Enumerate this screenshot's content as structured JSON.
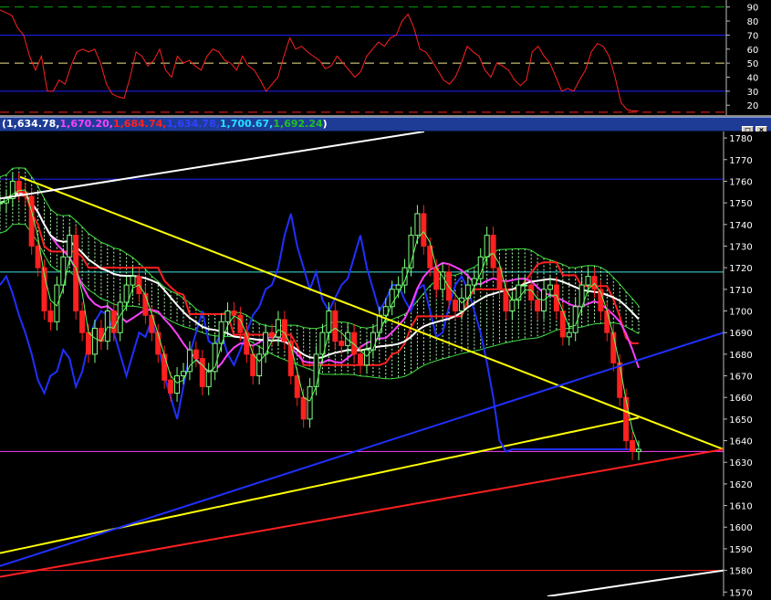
{
  "window": {
    "legend_values": [
      {
        "text": "(1,634.78,",
        "color": "#ffffff"
      },
      {
        "text": "1,670.20,",
        "color": "#ff40ff"
      },
      {
        "text": "1,684.74,",
        "color": "#ff2020"
      },
      {
        "text": "1,634.78,",
        "color": "#3040ff"
      },
      {
        "text": "1,700.67,",
        "color": "#20e0ff"
      },
      {
        "text": "1,692.24",
        "color": "#20c020"
      },
      {
        "text": ")",
        "color": "#ffffff"
      }
    ],
    "restore_label": "□",
    "close_label": "×"
  },
  "chart_data": [
    {
      "type": "line",
      "panel": "oscillator",
      "yticks": [
        20,
        30,
        40,
        50,
        60,
        70,
        80,
        90
      ],
      "ylim": [
        13,
        95
      ],
      "reference_lines": [
        {
          "value": 90,
          "color": "#00a000",
          "style": "dashed"
        },
        {
          "value": 70,
          "color": "#2020ff",
          "style": "solid"
        },
        {
          "value": 50,
          "color": "#f0e68c",
          "style": "dashed"
        },
        {
          "value": 30,
          "color": "#2020ff",
          "style": "solid"
        },
        {
          "value": 15,
          "color": "#ff2020",
          "style": "dashed"
        }
      ],
      "series": [
        {
          "color": "#ff2020",
          "values": [
            88,
            86,
            84,
            75,
            70,
            55,
            45,
            55,
            30,
            30,
            38,
            35,
            48,
            58,
            60,
            58,
            60,
            50,
            35,
            28,
            26,
            25,
            40,
            58,
            55,
            48,
            52,
            60,
            45,
            40,
            55,
            50,
            52,
            48,
            45,
            55,
            60,
            58,
            52,
            50,
            45,
            55,
            48,
            45,
            38,
            30,
            35,
            40,
            55,
            68,
            60,
            62,
            58,
            55,
            52,
            46,
            48,
            55,
            50,
            45,
            40,
            44,
            55,
            60,
            65,
            62,
            68,
            70,
            80,
            85,
            75,
            60,
            58,
            52,
            45,
            38,
            35,
            40,
            50,
            62,
            58,
            55,
            45,
            40,
            50,
            48,
            45,
            38,
            34,
            38,
            58,
            62,
            55,
            50,
            40,
            30,
            32,
            30,
            38,
            45,
            58,
            64,
            62,
            55,
            40,
            22,
            17,
            16,
            16
          ]
        }
      ]
    },
    {
      "type": "candlestick",
      "panel": "price",
      "yticks": [
        1570,
        1580,
        1590,
        1600,
        1610,
        1620,
        1630,
        1640,
        1650,
        1660,
        1670,
        1680,
        1690,
        1700,
        1710,
        1720,
        1730,
        1740,
        1750,
        1760,
        1770,
        1780
      ],
      "ylim": [
        1568,
        1783
      ],
      "horizontal_lines": [
        {
          "value": 1761,
          "color": "#2020ff"
        },
        {
          "value": 1718,
          "color": "#40e0e0"
        },
        {
          "value": 1635,
          "color": "#ff40ff"
        },
        {
          "value": 1580,
          "color": "#ff2020"
        }
      ],
      "closes": [
        1750,
        1752,
        1760,
        1755,
        1753,
        1730,
        1720,
        1700,
        1695,
        1712,
        1725,
        1735,
        1700,
        1690,
        1680,
        1692,
        1686,
        1700,
        1690,
        1704,
        1712,
        1716,
        1708,
        1698,
        1690,
        1680,
        1668,
        1662,
        1670,
        1672,
        1682,
        1678,
        1665,
        1672,
        1685,
        1695,
        1700,
        1698,
        1690,
        1680,
        1670,
        1680,
        1690,
        1688,
        1696,
        1686,
        1670,
        1660,
        1650,
        1665,
        1680,
        1690,
        1700,
        1686,
        1684,
        1690,
        1680,
        1675,
        1682,
        1690,
        1698,
        1702,
        1710,
        1712,
        1720,
        1735,
        1745,
        1730,
        1720,
        1710,
        1718,
        1705,
        1700,
        1706,
        1712,
        1715,
        1725,
        1735,
        1720,
        1710,
        1700,
        1705,
        1712,
        1712,
        1705,
        1700,
        1710,
        1712,
        1700,
        1688,
        1690,
        1702,
        1712,
        1716,
        1710,
        1700,
        1690,
        1676,
        1660,
        1640,
        1635,
        1636
      ]
    }
  ]
}
